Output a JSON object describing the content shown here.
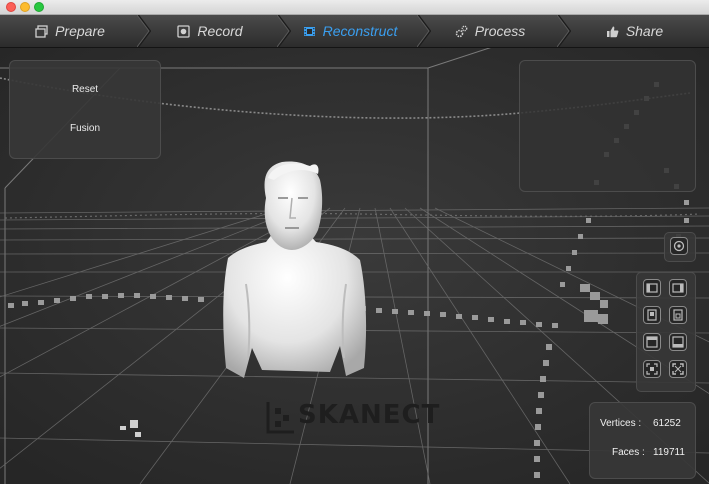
{
  "window": {
    "controls": [
      "close",
      "minimize",
      "maximize"
    ]
  },
  "nav": {
    "tabs": [
      {
        "label": "Prepare",
        "icon": "photos-icon",
        "active": false
      },
      {
        "label": "Record",
        "icon": "record-icon",
        "active": false
      },
      {
        "label": "Reconstruct",
        "icon": "film-icon",
        "active": true
      },
      {
        "label": "Process",
        "icon": "gears-icon",
        "active": false
      },
      {
        "label": "Share",
        "icon": "thumbs-up-icon",
        "active": false
      }
    ],
    "active_color": "#3a9ff0"
  },
  "left_panel": {
    "reset_label": "Reset",
    "fusion_label": "Fusion"
  },
  "toolbar": {
    "top_icon": "camera-target-icon",
    "buttons": [
      "view-left-icon",
      "view-right-icon",
      "view-front-icon",
      "view-back-icon",
      "view-top-icon",
      "view-bottom-icon",
      "zoom-fit-icon",
      "zoom-extents-icon"
    ]
  },
  "stats": {
    "vertices_label": "Vertices :",
    "vertices_value": "61252",
    "faces_label": "Faces :",
    "faces_value": "119711"
  },
  "watermark": {
    "text": "SKANECT"
  }
}
